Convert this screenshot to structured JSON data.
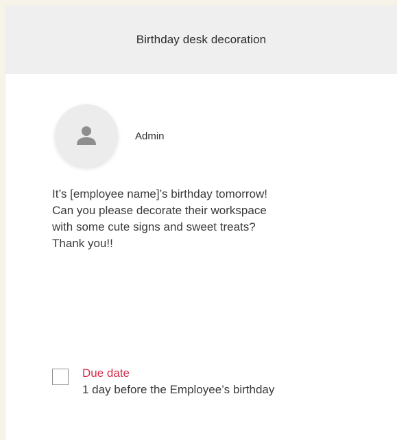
{
  "task": {
    "title": "Birthday desk decoration",
    "author": {
      "name": "Admin",
      "avatar_icon": "user-icon"
    },
    "message_lines": [
      "It’s [employee name]’s birthday tomorrow!",
      "Can you please decorate their workspace",
      "with some cute signs and sweet treats?",
      "Thank you!!"
    ],
    "due": {
      "label": "Due date",
      "value": "1 day before the Employee’s birthday",
      "checked": false
    }
  },
  "colors": {
    "page_background": "#f7f3e8",
    "header_background": "#efefef",
    "due_label": "#d22f4b",
    "text": "#3a3a3a"
  }
}
